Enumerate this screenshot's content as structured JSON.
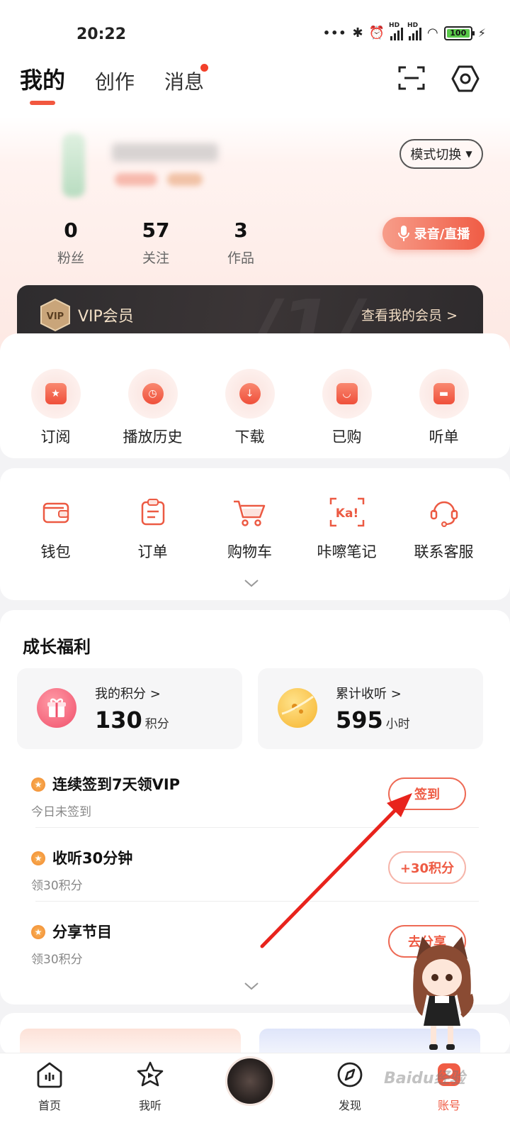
{
  "status_bar": {
    "time": "20:22",
    "battery": "100",
    "hd1": "HD",
    "hd2": "HD"
  },
  "header": {
    "tabs": [
      {
        "label": "我的"
      },
      {
        "label": "创作"
      },
      {
        "label": "消息"
      }
    ]
  },
  "profile": {
    "mode_switch": "模式切换",
    "stats": [
      {
        "num": "0",
        "label": "粉丝"
      },
      {
        "num": "57",
        "label": "关注"
      },
      {
        "num": "3",
        "label": "作品"
      }
    ],
    "record_button": "录音/直播",
    "vip": {
      "badge": "VIP",
      "title": "VIP会员",
      "link": "查看我的会员 >"
    }
  },
  "quick_actions": [
    {
      "label": "订阅",
      "icon": "subscribe-icon"
    },
    {
      "label": "播放历史",
      "icon": "history-icon"
    },
    {
      "label": "下载",
      "icon": "download-icon"
    },
    {
      "label": "已购",
      "icon": "purchased-icon"
    },
    {
      "label": "听单",
      "icon": "playlist-icon"
    }
  ],
  "services": [
    {
      "label": "钱包",
      "icon": "wallet-icon"
    },
    {
      "label": "订单",
      "icon": "order-icon"
    },
    {
      "label": "购物车",
      "icon": "cart-icon"
    },
    {
      "label": "咔嚓笔记",
      "icon": "kacha-note-icon",
      "glyph": "Ka!"
    },
    {
      "label": "联系客服",
      "icon": "customer-service-icon"
    }
  ],
  "growth": {
    "title": "成长福利",
    "points": {
      "label": "我的积分 >",
      "value": "130",
      "unit": "积分"
    },
    "listen": {
      "label": "累计收听 >",
      "value": "595",
      "unit": "小时"
    },
    "tasks": [
      {
        "title": "连续签到7天领VIP",
        "sub": "今日未签到",
        "button": "签到"
      },
      {
        "title": "收听30分钟",
        "sub": "领30积分",
        "button": "+30积分"
      },
      {
        "title": "分享节目",
        "sub": "领30积分",
        "button": "去分享"
      }
    ]
  },
  "bottom_nav": [
    {
      "label": "首页",
      "icon": "home-icon"
    },
    {
      "label": "我听",
      "icon": "my-listen-icon"
    },
    {
      "label": "",
      "icon": "now-playing-disc"
    },
    {
      "label": "发现",
      "icon": "discover-icon"
    },
    {
      "label": "账号",
      "icon": "account-icon"
    }
  ],
  "watermark": "Baidu经验",
  "colors": {
    "accent": "#f05c45",
    "vip_dark": "#2e2c2e",
    "vip_gold": "#f3e0c7"
  }
}
